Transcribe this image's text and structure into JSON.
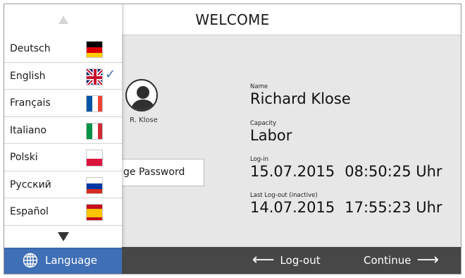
{
  "header": {
    "title": "WELCOME"
  },
  "user": {
    "avatar_name": "R. Klose",
    "change_password_label": "ge Password",
    "name_label": "Name",
    "name": "Richard Klose",
    "capacity_label": "Capacity",
    "capacity": "Labor",
    "login_label": "Log-in",
    "login_date": "15.07.2015",
    "login_time": "08:50:25 Uhr",
    "logout_label": "Last Log-out (inactive)",
    "logout_date": "14.07.2015",
    "logout_time": "17:55:23 Uhr"
  },
  "language_menu": {
    "up_icon": "triangle-up-icon",
    "down_icon": "triangle-down-icon",
    "items": [
      {
        "label": "Deutsch",
        "flag": "germany-flag-icon",
        "selected": false
      },
      {
        "label": "English",
        "flag": "uk-flag-icon",
        "selected": true
      },
      {
        "label": "Français",
        "flag": "france-flag-icon",
        "selected": false
      },
      {
        "label": "Italiano",
        "flag": "italy-flag-icon",
        "selected": false
      },
      {
        "label": "Polski",
        "flag": "poland-flag-icon",
        "selected": false
      },
      {
        "label": "Русский",
        "flag": "russia-flag-icon",
        "selected": false
      },
      {
        "label": "Español",
        "flag": "spain-flag-icon",
        "selected": false
      }
    ]
  },
  "bottom_bar": {
    "language_label": "Language",
    "logout_label": "Log-out",
    "continue_label": "Continue"
  },
  "colors": {
    "accent": "#3f6fb5",
    "bar": "#474747",
    "background": "#e7e7e7"
  }
}
